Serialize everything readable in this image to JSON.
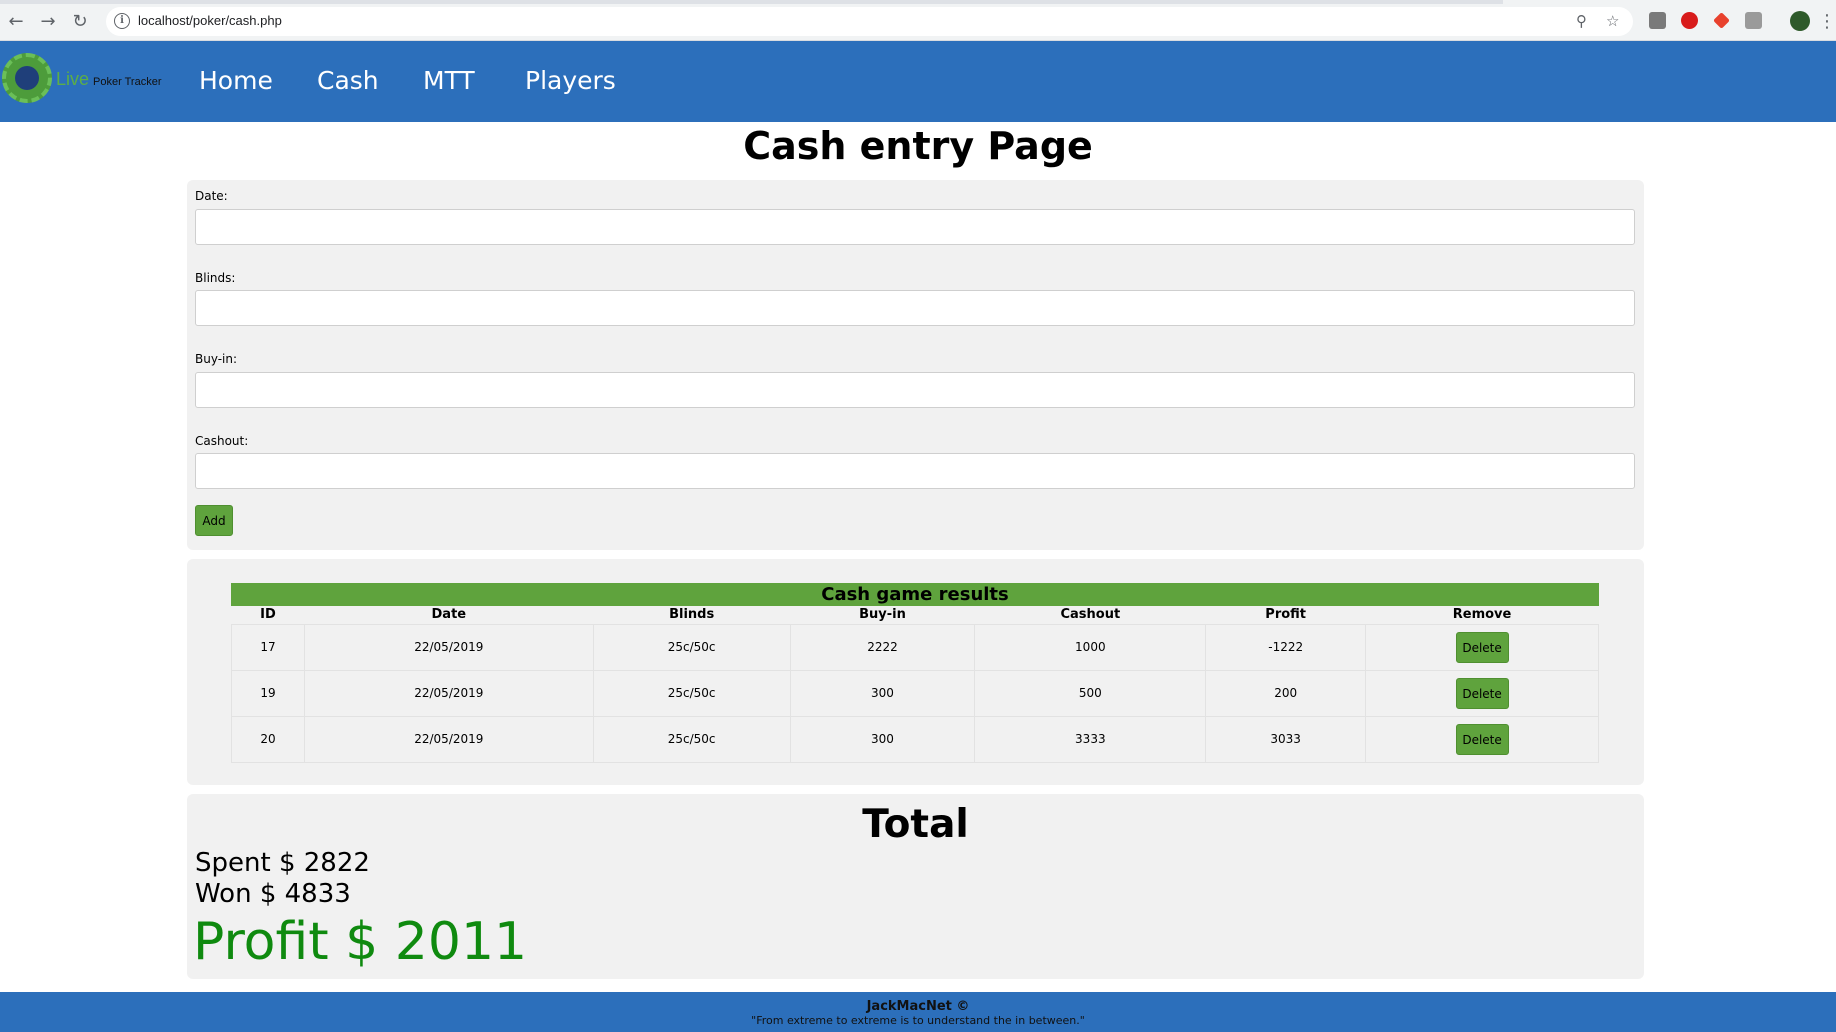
{
  "browser": {
    "url": "localhost/poker/cash.php",
    "back_icon": "←",
    "forward_icon": "→",
    "reload_icon": "↻",
    "zoom_icon": "⚲",
    "star_icon": "☆",
    "menu_icon": "⋮"
  },
  "nav": {
    "logo_text": "Live",
    "logo_sub": "Poker Tracker",
    "links": [
      "Home",
      "Cash",
      "MTT",
      "Players"
    ]
  },
  "page_title": "Cash entry Page",
  "form": {
    "fields": [
      {
        "label": "Date:",
        "value": ""
      },
      {
        "label": "Blinds:",
        "value": ""
      },
      {
        "label": "Buy-in:",
        "value": ""
      },
      {
        "label": "Cashout:",
        "value": ""
      }
    ],
    "add_label": "Add"
  },
  "results": {
    "caption": "Cash game results",
    "headers": [
      "ID",
      "Date",
      "Blinds",
      "Buy-in",
      "Cashout",
      "Profit",
      "Remove"
    ],
    "rows": [
      {
        "id": "17",
        "date": "22/05/2019",
        "blinds": "25c/50c",
        "buyin": "2222",
        "cashout": "1000",
        "profit": "-1222",
        "remove": "Delete"
      },
      {
        "id": "19",
        "date": "22/05/2019",
        "blinds": "25c/50c",
        "buyin": "300",
        "cashout": "500",
        "profit": "200",
        "remove": "Delete"
      },
      {
        "id": "20",
        "date": "22/05/2019",
        "blinds": "25c/50c",
        "buyin": "300",
        "cashout": "3333",
        "profit": "3033",
        "remove": "Delete"
      }
    ]
  },
  "total": {
    "title": "Total",
    "spent": "Spent $ 2822",
    "won": "Won $ 4833",
    "profit": "Profit $ 2011"
  },
  "footer": {
    "brand": "JackMacNet ©",
    "quote": "\"From extreme to extreme is to understand the in between.\""
  },
  "colors": {
    "nav": "#2c6fbb",
    "accent_green": "#5fa33d",
    "profit_green": "#0f8a0f"
  }
}
